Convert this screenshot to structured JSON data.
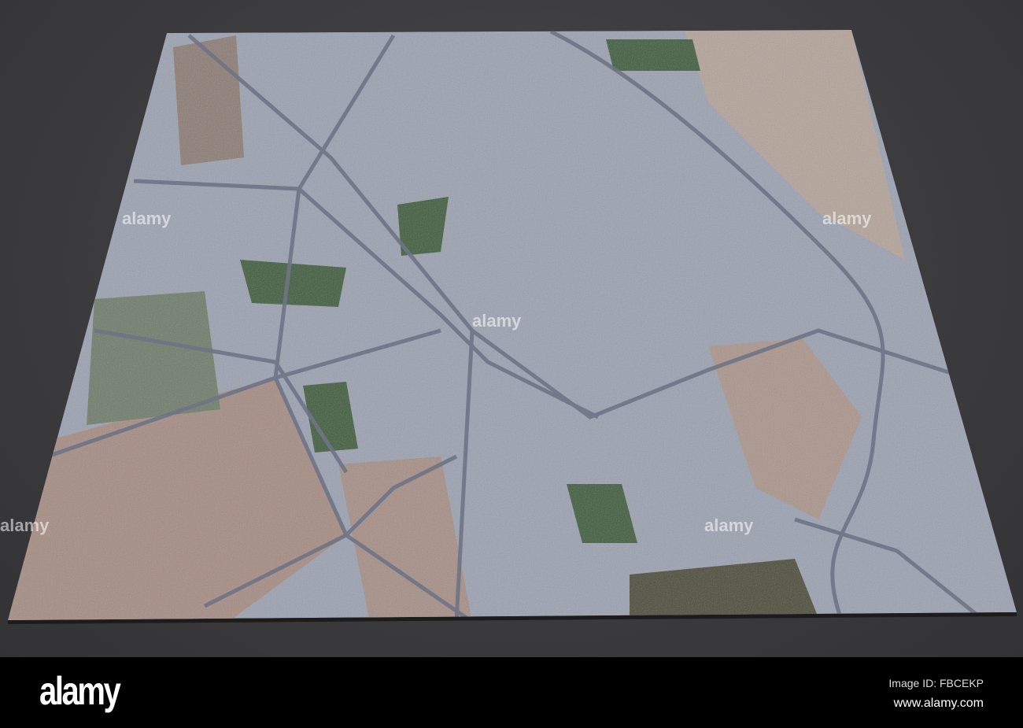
{
  "watermark": {
    "brand": "alamy"
  },
  "footer": {
    "logo": "alamy",
    "image_id": "Image ID: FBCEKP",
    "website": "www.alamy.com"
  },
  "colors": {
    "background": "#3d3d3f",
    "urban": "#9aa0b0",
    "desert": "#a48a80",
    "vegetation": "#3d5a3a",
    "footer": "#000000"
  }
}
